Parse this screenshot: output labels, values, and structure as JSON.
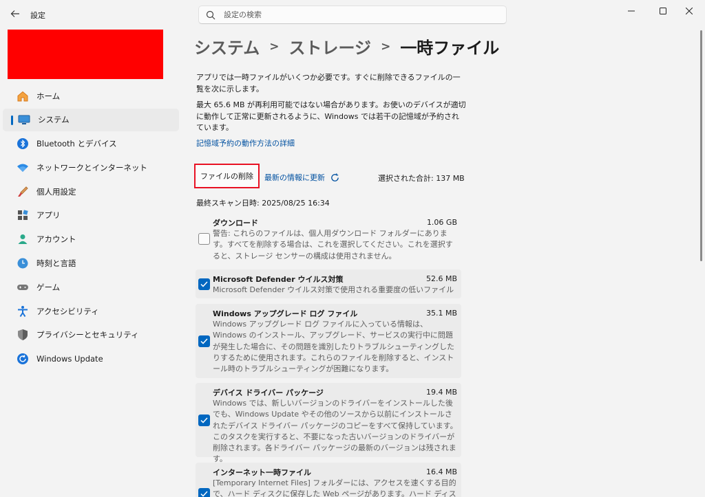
{
  "app": {
    "title": "設定"
  },
  "search": {
    "placeholder": "設定の検索"
  },
  "sidebar": {
    "items": [
      {
        "label": "ホーム",
        "icon": "home-icon"
      },
      {
        "label": "システム",
        "icon": "system-icon",
        "active": true
      },
      {
        "label": "Bluetooth とデバイス",
        "icon": "bluetooth-icon"
      },
      {
        "label": "ネットワークとインターネット",
        "icon": "network-icon"
      },
      {
        "label": "個人用設定",
        "icon": "personalization-icon"
      },
      {
        "label": "アプリ",
        "icon": "apps-icon"
      },
      {
        "label": "アカウント",
        "icon": "accounts-icon"
      },
      {
        "label": "時刻と言語",
        "icon": "time-language-icon"
      },
      {
        "label": "ゲーム",
        "icon": "gaming-icon"
      },
      {
        "label": "アクセシビリティ",
        "icon": "accessibility-icon"
      },
      {
        "label": "プライバシーとセキュリティ",
        "icon": "privacy-icon"
      },
      {
        "label": "Windows Update",
        "icon": "windows-update-icon"
      }
    ]
  },
  "breadcrumb": {
    "crumb1": "システム",
    "crumb2": "ストレージ",
    "current": "一時ファイル"
  },
  "main": {
    "intro": "アプリでは一時ファイルがいくつか必要です。すぐに削除できるファイルの一覧を次に示します。",
    "reserved_note": "最大 65.6 MB が再利用可能ではない場合があります。お使いのデバイスが適切に動作して正常に更新されるように、Windows では若干の記憶域が予約されています。",
    "reserved_link": "記憶域予約の動作方法の詳細",
    "delete_button": "ファイルの削除",
    "refresh_link": "最新の情報に更新",
    "total_selected": "選択された合計: 137 MB",
    "last_scan": "最終スキャン日時: 2025/08/25 16:34"
  },
  "files": [
    {
      "name": "ダウンロード",
      "size": "1.06 GB",
      "checked": false,
      "desc": "警告: これらのファイルは、個人用ダウンロード フォルダーにあります。すべてを削除する場合は、これを選択してください。これを選択すると、ストレージ センサーの構成は使用されません。"
    },
    {
      "name": "Microsoft Defender ウイルス対策",
      "size": "52.6 MB",
      "checked": true,
      "desc": "Microsoft Defender ウイルス対策で使用される重要度の低いファイル"
    },
    {
      "name": "Windows アップグレード ログ ファイル",
      "size": "35.1 MB",
      "checked": true,
      "desc": "Windows アップグレード ログ ファイルに入っている情報は、Windows のインストール、アップグレード、サービスの実行中に問題が発生した場合に、その問題を識別したりトラブルシューティングしたりするために使用されます。これらのファイルを削除すると、インストール時のトラブルシューティングが困難になります。"
    },
    {
      "name": "デバイス ドライバー パッケージ",
      "size": "19.4 MB",
      "checked": true,
      "desc": "Windows では、新しいバージョンのドライバーをインストールした後でも、Windows Update やその他のソースから以前にインストールされたデバイス ドライバー パッケージのコピーをすべて保持しています。このタスクを実行すると、不要になった古いバージョンのドライバーが削除されます。各ドライバー パッケージの最新のバージョンは残されます。"
    },
    {
      "name": "インターネット一時ファイル",
      "size": "16.4 MB",
      "checked": true,
      "desc": "[Temporary Internet Files] フォルダーには、アクセスを速くする目的で、ハード ディスクに保存した Web ページがあります。ハード ディスクに保存した"
    }
  ],
  "colors": {
    "accent": "#0067c0",
    "highlight_border": "#e81123",
    "profile_block": "#ff0000"
  }
}
